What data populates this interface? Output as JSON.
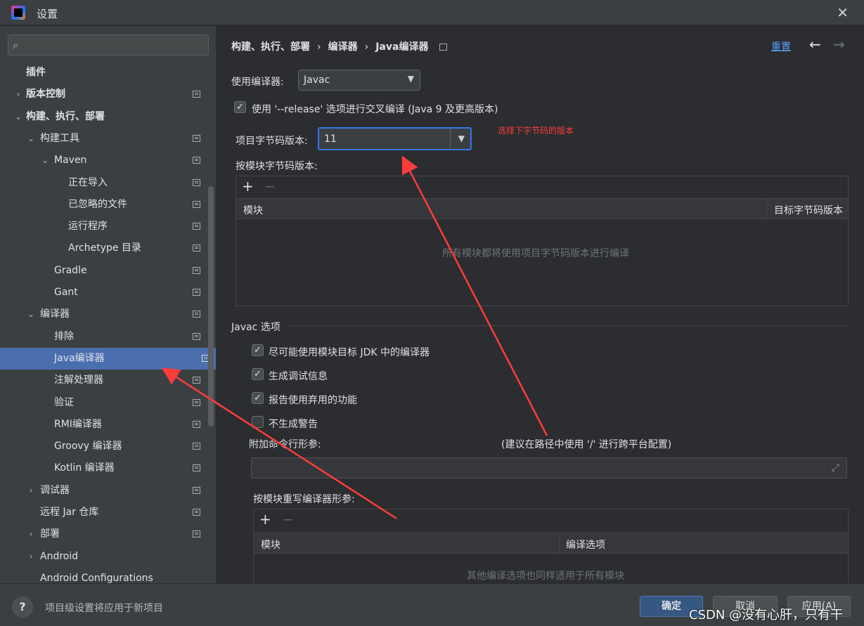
{
  "window": {
    "title": "设置"
  },
  "sidebar": {
    "search_placeholder": "",
    "items": [
      {
        "label": "插件",
        "chevron": "",
        "bold": true
      },
      {
        "label": "版本控制",
        "chevron": "›",
        "bold": true
      },
      {
        "label": "构建、执行、部署",
        "chevron": "⌄",
        "bold": true
      },
      {
        "label": "构建工具",
        "chevron": "⌄"
      },
      {
        "label": "Maven",
        "chevron": "⌄"
      },
      {
        "label": "正在导入",
        "chevron": ""
      },
      {
        "label": "已忽略的文件",
        "chevron": ""
      },
      {
        "label": "运行程序",
        "chevron": ""
      },
      {
        "label": "Archetype 目录",
        "chevron": ""
      },
      {
        "label": "Gradle",
        "chevron": ""
      },
      {
        "label": "Gant",
        "chevron": ""
      },
      {
        "label": "编译器",
        "chevron": "⌄"
      },
      {
        "label": "排除",
        "chevron": ""
      },
      {
        "label": "Java编译器",
        "chevron": "",
        "selected": true
      },
      {
        "label": "注解处理器",
        "chevron": ""
      },
      {
        "label": "验证",
        "chevron": ""
      },
      {
        "label": "RMI编译器",
        "chevron": ""
      },
      {
        "label": "Groovy 编译器",
        "chevron": ""
      },
      {
        "label": "Kotlin 编译器",
        "chevron": ""
      },
      {
        "label": "调试器",
        "chevron": "›"
      },
      {
        "label": "远程 Jar 仓库",
        "chevron": ""
      },
      {
        "label": "部署",
        "chevron": "›"
      },
      {
        "label": "Android",
        "chevron": "›"
      },
      {
        "label": "Android Configurations",
        "chevron": ""
      }
    ]
  },
  "header": {
    "breadcrumb": [
      "构建、执行、部署",
      "编译器",
      "Java编译器"
    ],
    "sep": "›",
    "reset_label": "重置",
    "back_icon": "←",
    "forward_icon": "→"
  },
  "compiler": {
    "use_compiler_label": "使用编译器:",
    "use_compiler_value": "Javac",
    "release_option_label": "使用 '--release' 选项进行交叉编译 (Java 9 及更高版本)",
    "release_option_checked": true,
    "bytecode_label": "项目字节码版本:",
    "bytecode_value": "11",
    "annotation": "选择下字节码的版本",
    "per_module_label": "按模块字节码版本:",
    "per_module_table": {
      "add_icon": "+",
      "remove_icon": "−",
      "col_module": "模块",
      "col_target": "目标字节码版本",
      "empty_text": "所有模块都将使用项目字节码版本进行编译"
    }
  },
  "javac": {
    "section_title": "Javac 选项",
    "options": [
      {
        "label": "尽可能使用模块目标 JDK 中的编译器",
        "checked": true
      },
      {
        "label": "生成调试信息",
        "checked": true
      },
      {
        "label": "报告使用弃用的功能",
        "checked": true
      },
      {
        "label": "不生成警告",
        "checked": false
      }
    ],
    "extra_args_label": "附加命令行形参:",
    "extra_args_hint": "(建议在路径中使用 '/' 进行跨平台配置)",
    "extra_args_value": "",
    "override_label": "按模块重写编译器形参:",
    "override_table": {
      "add_icon": "+",
      "remove_icon": "−",
      "col_module": "模块",
      "col_options": "编译选项",
      "empty_text": "其他编译选项也同样适用于所有模块"
    }
  },
  "footer": {
    "help_label": "?",
    "hint": "项目级设置将应用于新项目",
    "ok_label": "确定",
    "cancel_label": "取消",
    "apply_label": "应用(A)",
    "watermark": "CSDN @没有心肝，只有干"
  },
  "colors": {
    "accent": "#4b6eaf",
    "link": "#589df6",
    "annotation": "#ff3c3c"
  }
}
